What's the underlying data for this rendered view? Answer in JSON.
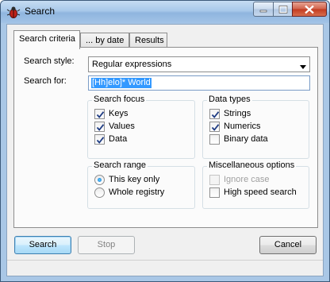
{
  "window": {
    "title": "Search",
    "controls": {
      "minimize": "minimize",
      "maximize": "maximize",
      "close": "close"
    }
  },
  "tabs": [
    {
      "label": "Search criteria",
      "active": true
    },
    {
      "label": "... by date",
      "active": false
    },
    {
      "label": "Results",
      "active": false
    }
  ],
  "form": {
    "style_label": "Search style:",
    "style_value": "Regular expressions",
    "for_label": "Search for:",
    "for_value": "[Hh]elo]* World"
  },
  "search_focus": {
    "title": "Search focus",
    "items": [
      {
        "label": "Keys",
        "checked": true
      },
      {
        "label": "Values",
        "checked": true
      },
      {
        "label": "Data",
        "checked": true
      }
    ]
  },
  "data_types": {
    "title": "Data types",
    "items": [
      {
        "label": "Strings",
        "checked": true
      },
      {
        "label": "Numerics",
        "checked": true
      },
      {
        "label": "Binary data",
        "checked": false
      }
    ]
  },
  "search_range": {
    "title": "Search range",
    "items": [
      {
        "label": "This key only",
        "selected": true
      },
      {
        "label": "Whole registry",
        "selected": false
      }
    ]
  },
  "misc": {
    "title": "Miscellaneous options",
    "items": [
      {
        "label": "Ignore case",
        "checked": false,
        "disabled": true
      },
      {
        "label": "High speed search",
        "checked": false,
        "disabled": false
      }
    ]
  },
  "buttons": {
    "search": "Search",
    "stop": "Stop",
    "cancel": "Cancel"
  },
  "colors": {
    "selection": "#3399ff",
    "check": "#1f3c83",
    "title_gradient_top": "#c6dcf2"
  }
}
